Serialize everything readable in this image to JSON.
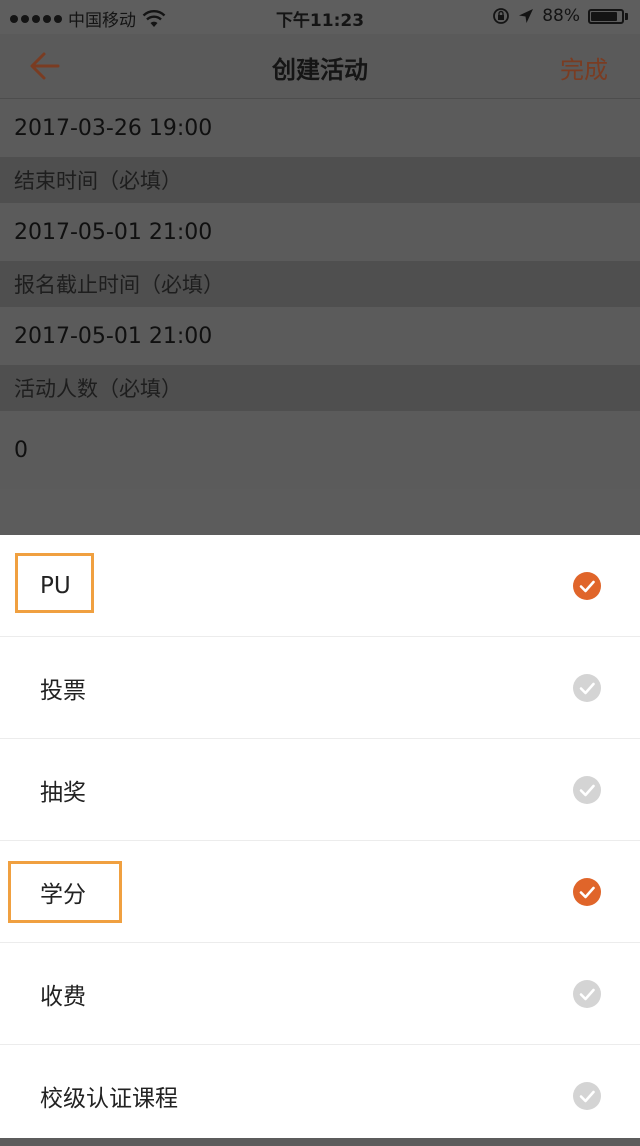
{
  "status_bar": {
    "carrier": "中国移动",
    "time": "下午11:23",
    "battery_percent": "88%",
    "battery_level": 0.88
  },
  "nav": {
    "title": "创建活动",
    "done_label": "完成"
  },
  "form": {
    "start_time_value": "2017-03-26 19:00",
    "end_time_label": "结束时间（必填）",
    "end_time_value": "2017-05-01 21:00",
    "signup_deadline_label": "报名截止时间（必填）",
    "signup_deadline_value": "2017-05-01 21:00",
    "participants_label": "活动人数（必填）",
    "participants_value": "0"
  },
  "options": [
    {
      "label": "PU",
      "checked": true,
      "highlighted": true
    },
    {
      "label": "投票",
      "checked": false,
      "highlighted": false
    },
    {
      "label": "抽奖",
      "checked": false,
      "highlighted": false
    },
    {
      "label": "学分",
      "checked": true,
      "highlighted": true
    },
    {
      "label": "收费",
      "checked": false,
      "highlighted": false
    },
    {
      "label": "校级认证课程",
      "checked": false,
      "highlighted": false
    }
  ],
  "colors": {
    "accent": "#e0652a",
    "unchecked": "#d4d4d4",
    "highlight_box": "#f0a040",
    "done_text": "#7a3c22"
  }
}
